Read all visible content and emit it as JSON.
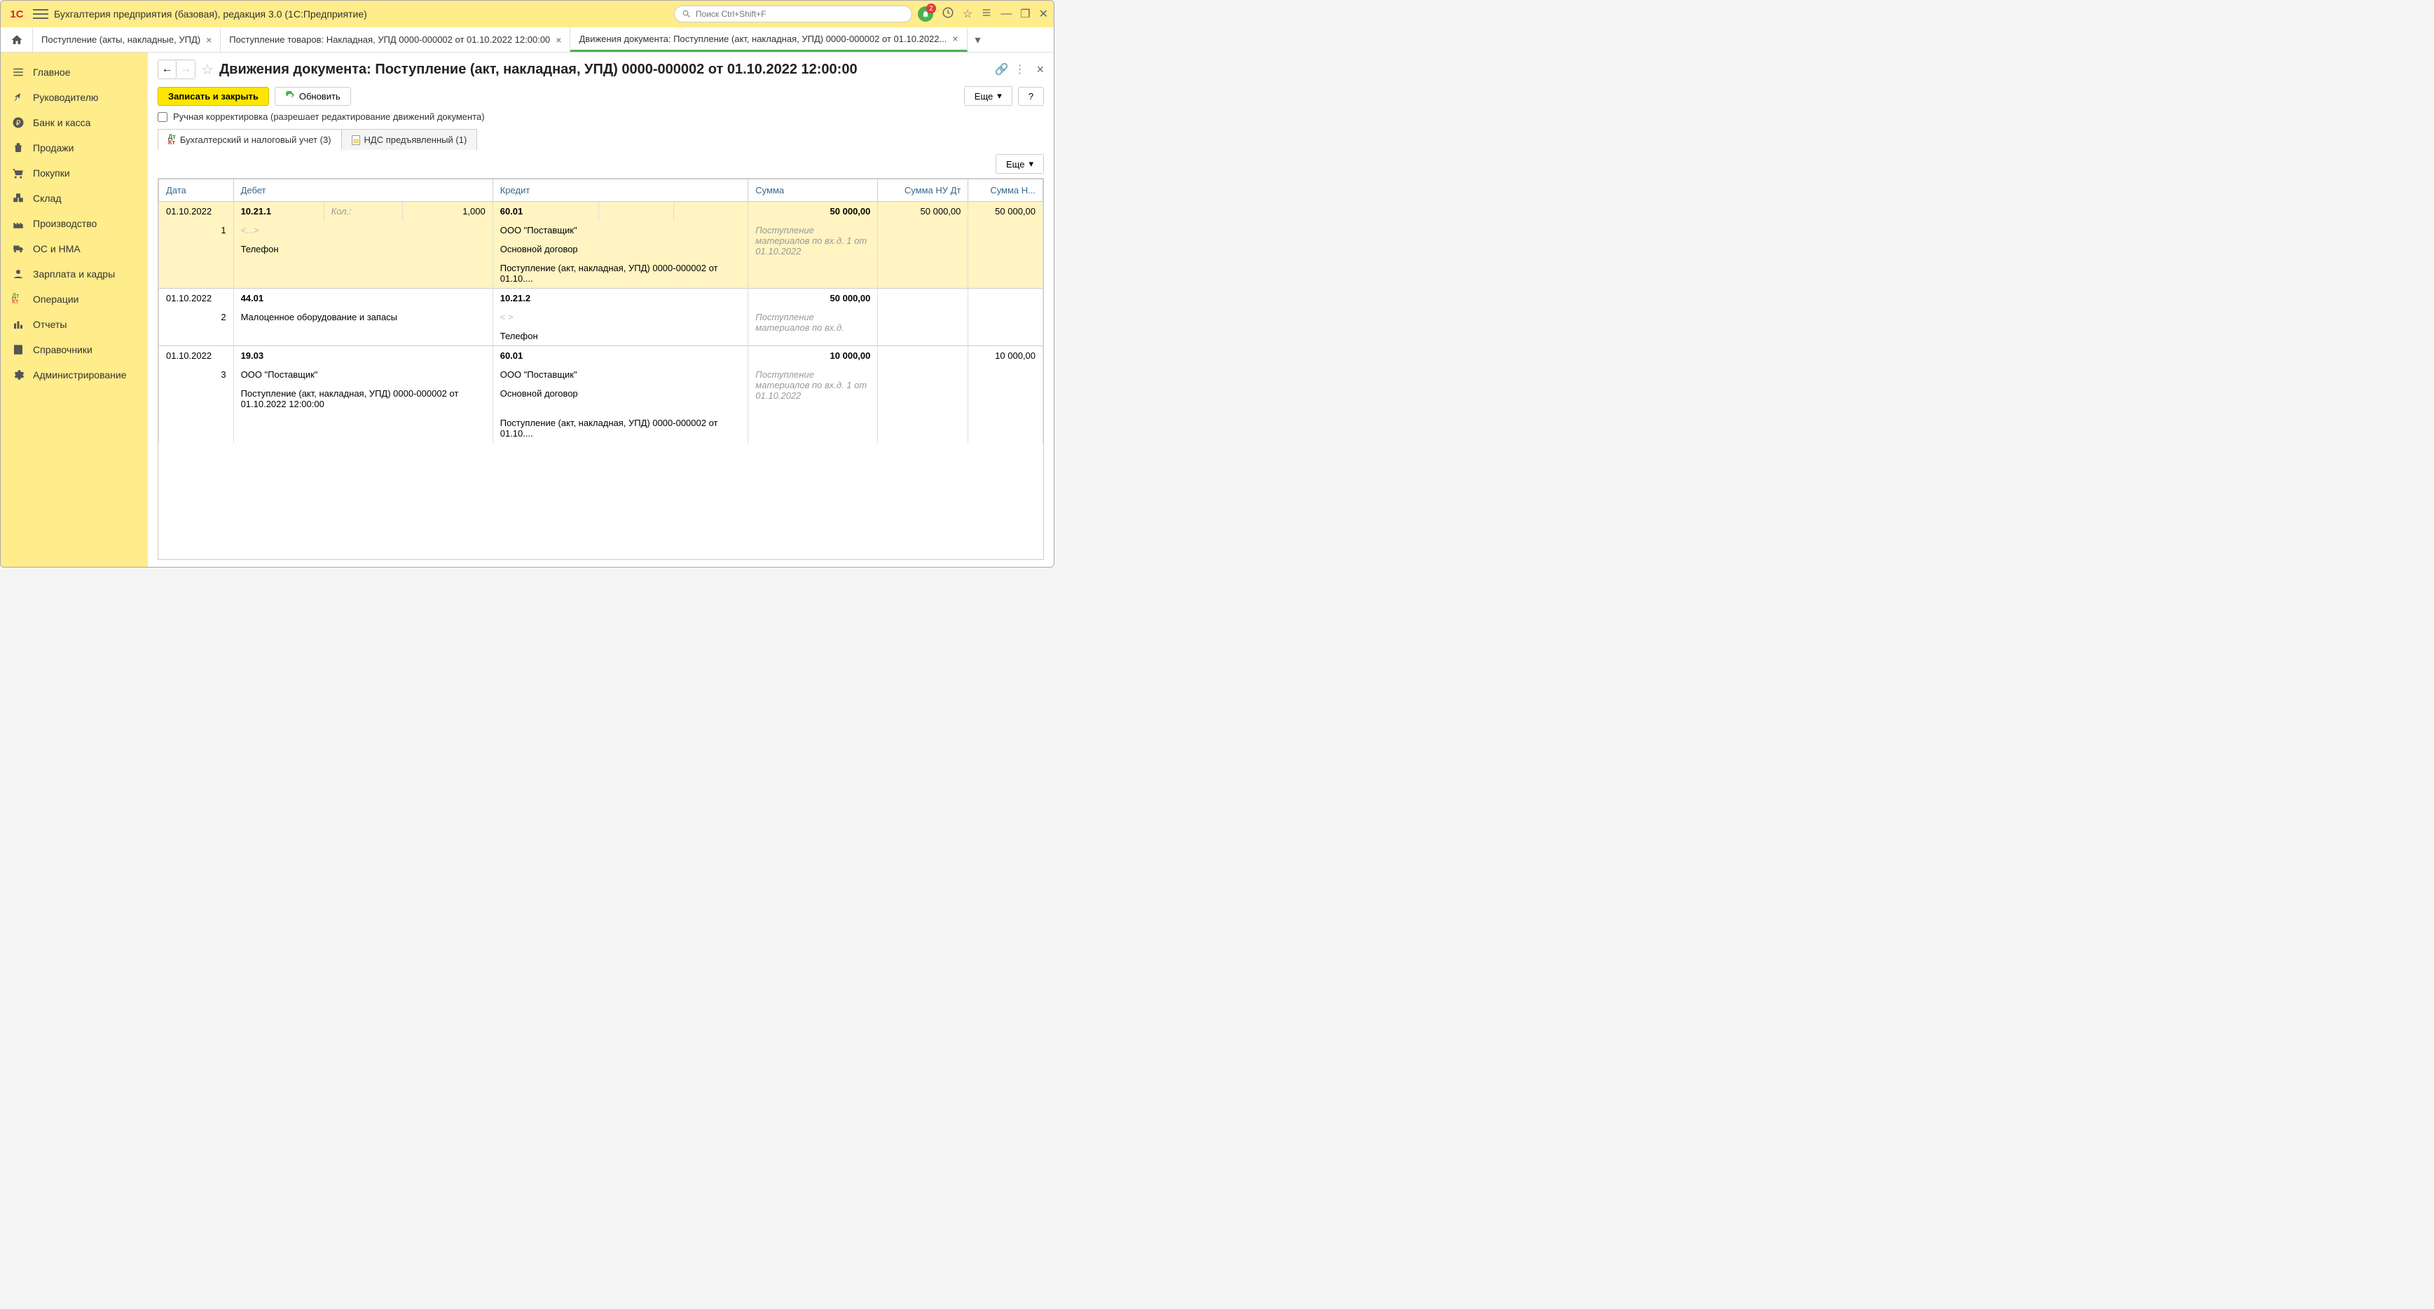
{
  "app_title": "Бухгалтерия предприятия (базовая), редакция 3.0  (1С:Предприятие)",
  "search_placeholder": "Поиск Ctrl+Shift+F",
  "notification_badge": "2",
  "tabs": [
    {
      "label": "Поступление (акты, накладные, УПД)"
    },
    {
      "label": "Поступление товаров: Накладная, УПД 0000-000002 от 01.10.2022 12:00:00"
    },
    {
      "label": "Движения документа: Поступление (акт, накладная, УПД) 0000-000002 от 01.10.2022..."
    }
  ],
  "sidebar": {
    "items": [
      "Главное",
      "Руководителю",
      "Банк и касса",
      "Продажи",
      "Покупки",
      "Склад",
      "Производство",
      "ОС и НМА",
      "Зарплата и кадры",
      "Операции",
      "Отчеты",
      "Справочники",
      "Администрирование"
    ]
  },
  "page": {
    "title": "Движения документа: Поступление (акт, накладная, УПД) 0000-000002 от 01.10.2022 12:00:00",
    "save_close": "Записать и закрыть",
    "refresh": "Обновить",
    "more": "Еще",
    "help": "?",
    "manual_edit": "Ручная корректировка (разрешает редактирование движений документа)",
    "inner_tabs": {
      "accounting": "Бухгалтерский и налоговый учет (3)",
      "vat": "НДС предъявленный (1)"
    }
  },
  "grid": {
    "headers": {
      "date": "Дата",
      "debit": "Дебет",
      "credit": "Кредит",
      "sum": "Сумма",
      "sum_nu_dt": "Сумма НУ Дт",
      "sum_nu_kt": "Сумма Н..."
    },
    "rows": [
      {
        "date": "01.10.2022",
        "row_no": "1",
        "dt_acc": "10.21.1",
        "dt_qty_lbl": "Кол.:",
        "dt_qty": "1,000",
        "dt_sub1": "<...>",
        "dt_sub2": "Телефон",
        "kt_acc": "60.01",
        "kt_sub1": "ООО \"Поставщик\"",
        "kt_sub2": "Основной договор",
        "kt_sub3": "Поступление (акт, накладная, УПД) 0000-000002 от 01.10....",
        "sum": "50 000,00",
        "sum_desc": "Поступление материалов по вх.д. 1 от 01.10.2022",
        "sum_nu_dt": "50 000,00",
        "sum_nu_kt": "50 000,00"
      },
      {
        "date": "01.10.2022",
        "row_no": "2",
        "dt_acc": "44.01",
        "dt_sub1": "Малоценное оборудование и запасы",
        "kt_acc": "10.21.2",
        "kt_sub1": "<   >",
        "kt_sub2": "Телефон",
        "sum": "50 000,00",
        "sum_desc": "Поступление материалов по вх.д."
      },
      {
        "date": "01.10.2022",
        "row_no": "3",
        "dt_acc": "19.03",
        "dt_sub1": "ООО \"Поставщик\"",
        "dt_sub2": "Поступление (акт, накладная, УПД) 0000-000002 от 01.10.2022 12:00:00",
        "kt_acc": "60.01",
        "kt_sub1": "ООО \"Поставщик\"",
        "kt_sub2": "Основной договор",
        "kt_sub3": "Поступление (акт, накладная, УПД) 0000-000002 от 01.10....",
        "sum": "10 000,00",
        "sum_desc": "Поступление материалов по вх.д. 1 от 01.10.2022",
        "sum_nu_kt": "10 000,00"
      }
    ]
  }
}
